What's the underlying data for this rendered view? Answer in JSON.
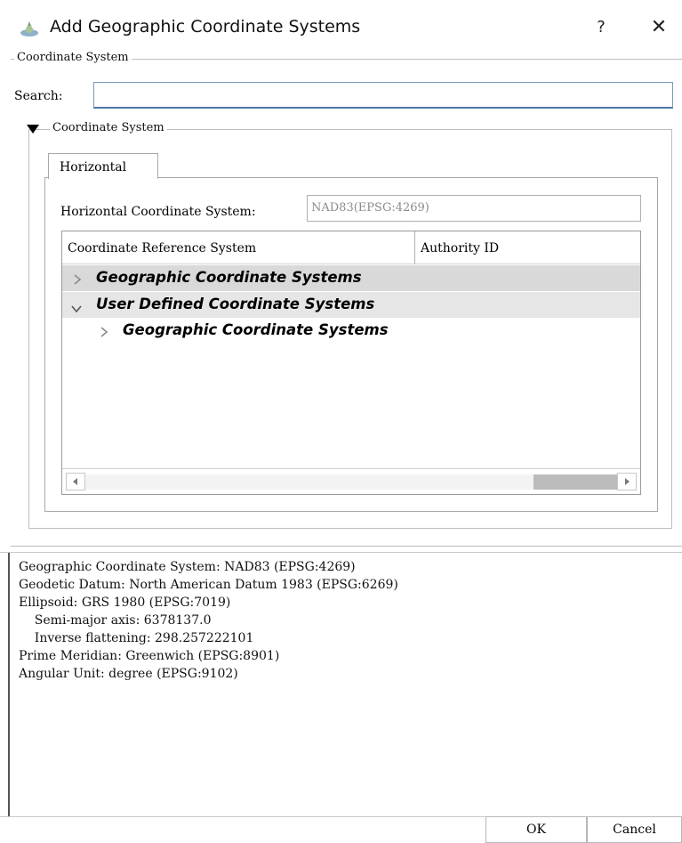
{
  "window": {
    "title": "Add Geographic Coordinate Systems",
    "help_label": "?",
    "close_label": "✕"
  },
  "coordinate_system_group": {
    "legend": "Coordinate System",
    "search_label": "Search:",
    "search_value": "",
    "inner_group": {
      "legend": "Coordinate System",
      "expanded": true,
      "tabs": [
        {
          "label": "Horizontal",
          "selected": true
        }
      ],
      "horizontal_cs_label": "Horizontal Coordinate System:",
      "horizontal_cs_value": "NAD83(EPSG:4269)",
      "table": {
        "columns": [
          "Coordinate Reference System",
          "Authority ID"
        ],
        "rows": [
          {
            "label": "Geographic Coordinate Systems",
            "expanded": false,
            "level": 0
          },
          {
            "label": "User Defined Coordinate Systems",
            "expanded": true,
            "level": 0
          },
          {
            "label": "Geographic Coordinate Systems",
            "expanded": false,
            "level": 1
          }
        ]
      }
    }
  },
  "details": {
    "lines": [
      "Geographic Coordinate System: NAD83 (EPSG:4269)",
      "Geodetic Datum: North American Datum 1983 (EPSG:6269)",
      "Ellipsoid: GRS 1980 (EPSG:7019)",
      "    Semi-major axis: 6378137.0",
      "    Inverse flattening: 298.257222101",
      "Prime Meridian: Greenwich (EPSG:8901)",
      "Angular Unit: degree (EPSG:9102)"
    ]
  },
  "buttons": {
    "ok": "OK",
    "cancel": "Cancel"
  },
  "colors": {
    "row_highlight": "#d9d9d9",
    "row_selected": "#e6e6e6",
    "search_focus_border": "#4a78a8"
  }
}
